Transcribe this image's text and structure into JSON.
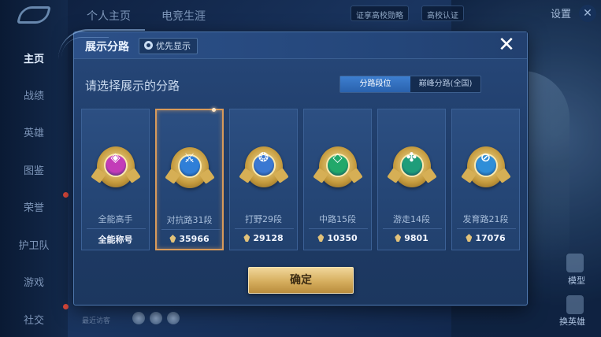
{
  "background": {
    "nav": [
      "主页",
      "战绩",
      "英雄",
      "图鉴",
      "荣誉",
      "护卫队",
      "游戏",
      "社交"
    ],
    "top_tabs": [
      "个人主页",
      "电竞生涯"
    ],
    "top_right": {
      "feature_label": "证享高校勋略",
      "campus_auth": "高校认证",
      "settings": "设置"
    },
    "recent_visitors": "最近访客",
    "right_side": {
      "model": "模型",
      "change_hero": "换英雄"
    }
  },
  "modal": {
    "title": "展示分路",
    "priority_label": "优先显示",
    "close_symbol": "✕",
    "prompt": "请选择展示的分路",
    "toggle": {
      "left": "分路段位",
      "right": "巅峰分路(全国)",
      "active": "left"
    },
    "cards": [
      {
        "label": "全能高手",
        "score_text": "全能称号",
        "score": "",
        "emblem_color": "#c33cb8",
        "glyph": "◈",
        "selected": false
      },
      {
        "label": "对抗路31段",
        "score": "35966",
        "emblem_color": "#2f7fd8",
        "glyph": "⚔",
        "selected": true
      },
      {
        "label": "打野29段",
        "score": "29128",
        "emblem_color": "#3a78d2",
        "glyph": "❂",
        "selected": false
      },
      {
        "label": "中路15段",
        "score": "10350",
        "emblem_color": "#22a86a",
        "glyph": "◇",
        "selected": false
      },
      {
        "label": "游走14段",
        "score": "9801",
        "emblem_color": "#1f9d7a",
        "glyph": "✤",
        "selected": false
      },
      {
        "label": "发育路21段",
        "score": "17076",
        "emblem_color": "#2f8ed8",
        "glyph": "⊘",
        "selected": false
      }
    ],
    "confirm_label": "确定"
  }
}
